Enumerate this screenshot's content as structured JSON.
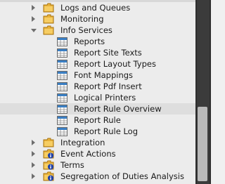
{
  "tree": {
    "items": [
      {
        "label": "Logs and Queues",
        "icon": "folder-icon",
        "state": "collapsed"
      },
      {
        "label": "Monitoring",
        "icon": "folder-icon",
        "state": "collapsed"
      },
      {
        "label": "Info Services",
        "icon": "folder-icon",
        "state": "expanded"
      },
      {
        "label": "Reports",
        "icon": "table-icon"
      },
      {
        "label": "Report Site Texts",
        "icon": "table-icon"
      },
      {
        "label": "Report Layout Types",
        "icon": "table-icon"
      },
      {
        "label": "Font Mappings",
        "icon": "table-icon"
      },
      {
        "label": "Report Pdf Insert",
        "icon": "table-icon"
      },
      {
        "label": "Logical Printers",
        "icon": "table-icon"
      },
      {
        "label": "Report Rule Overview",
        "icon": "table-icon",
        "selected": true
      },
      {
        "label": "Report Rule",
        "icon": "table-icon"
      },
      {
        "label": "Report Rule Log",
        "icon": "table-icon"
      },
      {
        "label": "Integration",
        "icon": "folder-icon",
        "state": "collapsed"
      },
      {
        "label": "Event Actions",
        "icon": "folder-info-icon",
        "state": "collapsed"
      },
      {
        "label": "Terms",
        "icon": "folder-info-icon",
        "state": "collapsed"
      },
      {
        "label": "Segregation of Duties Analysis",
        "icon": "folder-info-icon",
        "state": "collapsed"
      }
    ]
  },
  "colors": {
    "folder": "#e8b23a",
    "info_badge": "#1d3fa8",
    "table_header": "#3a7fc4",
    "scrollbar": "#2e2e2e"
  }
}
